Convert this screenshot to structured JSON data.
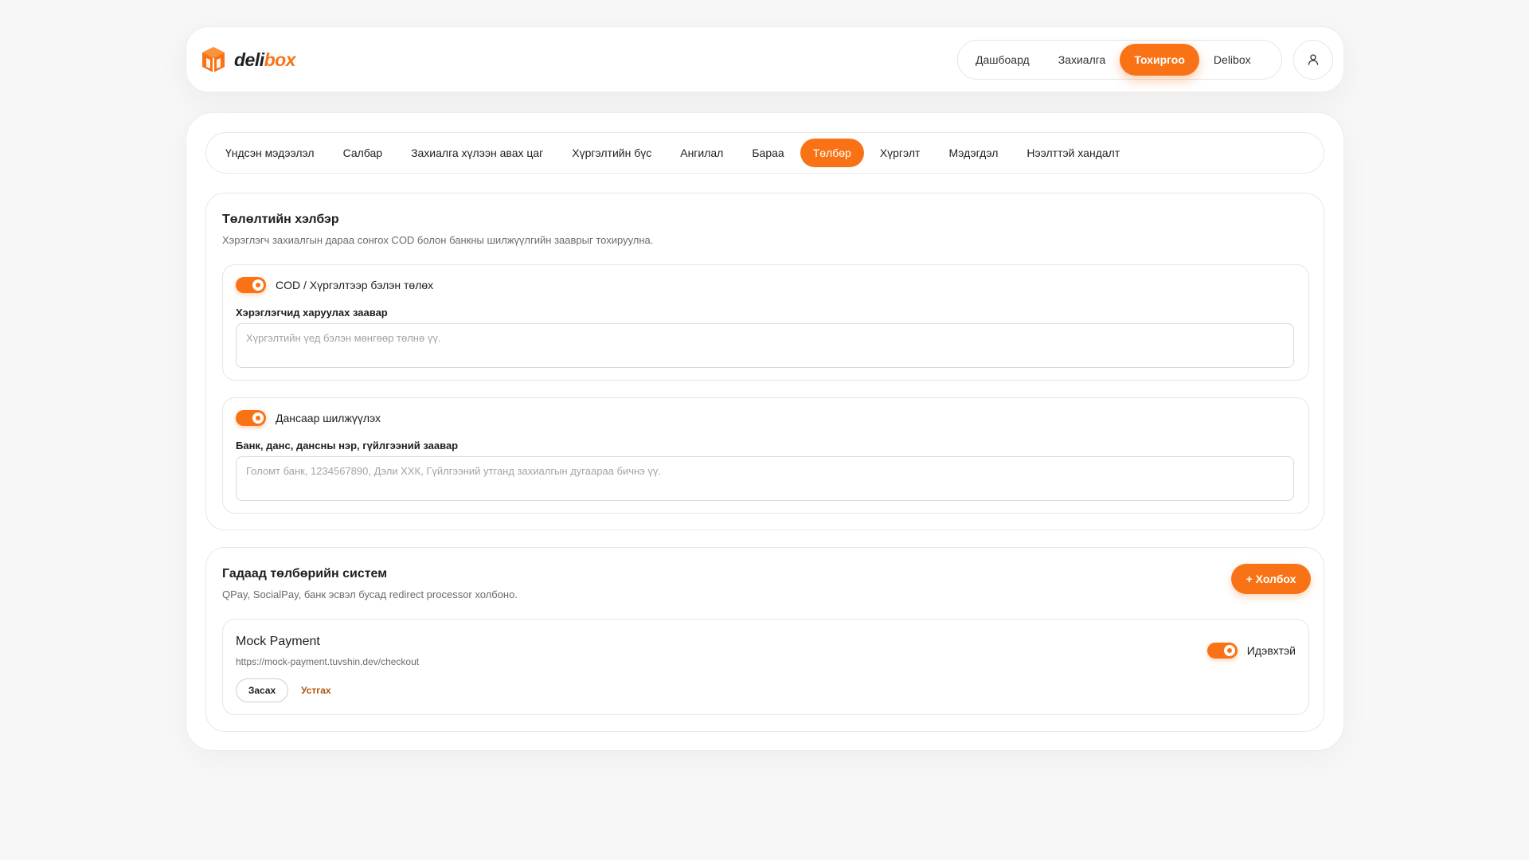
{
  "app": {
    "logo_prefix": "deli",
    "logo_suffix": "box",
    "accent_color": "#f97316"
  },
  "nav": {
    "items": [
      {
        "label": "Дашбоард",
        "active": false
      },
      {
        "label": "Захиалга",
        "active": false
      },
      {
        "label": "Тохиргоо",
        "active": true
      },
      {
        "label": "Delibox",
        "active": false
      }
    ],
    "user_icon": "user-icon"
  },
  "tabs": [
    {
      "label": "Үндсэн мэдээлэл",
      "active": false
    },
    {
      "label": "Салбар",
      "active": false
    },
    {
      "label": "Захиалга хүлээн авах цаг",
      "active": false
    },
    {
      "label": "Хүргэлтийн бүс",
      "active": false
    },
    {
      "label": "Ангилал",
      "active": false
    },
    {
      "label": "Бараа",
      "active": false
    },
    {
      "label": "Төлбөр",
      "active": true
    },
    {
      "label": "Хүргэлт",
      "active": false
    },
    {
      "label": "Мэдэгдэл",
      "active": false
    },
    {
      "label": "Нээлттэй хандалт",
      "active": false
    }
  ],
  "payment_methods": {
    "title": "Төлөлтийн хэлбэр",
    "subtitle": "Хэрэглэгч захиалгын дараа сонгох COD болон банкны шилжүүлгийн зааврыг тохируулна.",
    "cod": {
      "enabled": true,
      "label": "COD / Хүргэлтээр бэлэн төлөх",
      "field_label": "Хэрэглэгчид харуулах заавар",
      "value": "",
      "placeholder": "Хүргэлтийн үед бэлэн мөнгөөр төлнө үү."
    },
    "bank": {
      "enabled": true,
      "label": "Дансаар шилжүүлэх",
      "field_label": "Банк, данс, дансны нэр, гүйлгээний заавар",
      "value": "",
      "placeholder": "Голомт банк, 1234567890, Дэли ХХК, Гүйлгээний утганд захиалгын дугаараа бичнэ үү."
    }
  },
  "external_payments": {
    "title": "Гадаад төлбөрийн систем",
    "subtitle": "QPay, SocialPay, банк эсвэл бусад redirect processor холбоно.",
    "connect_label": "+ Холбох",
    "providers": [
      {
        "name": "Mock Payment",
        "url": "https://mock-payment.tuvshin.dev/checkout",
        "enabled": true,
        "status_label": "Идэвхтэй",
        "edit_label": "Засах",
        "remove_label": "Устгах"
      }
    ]
  }
}
